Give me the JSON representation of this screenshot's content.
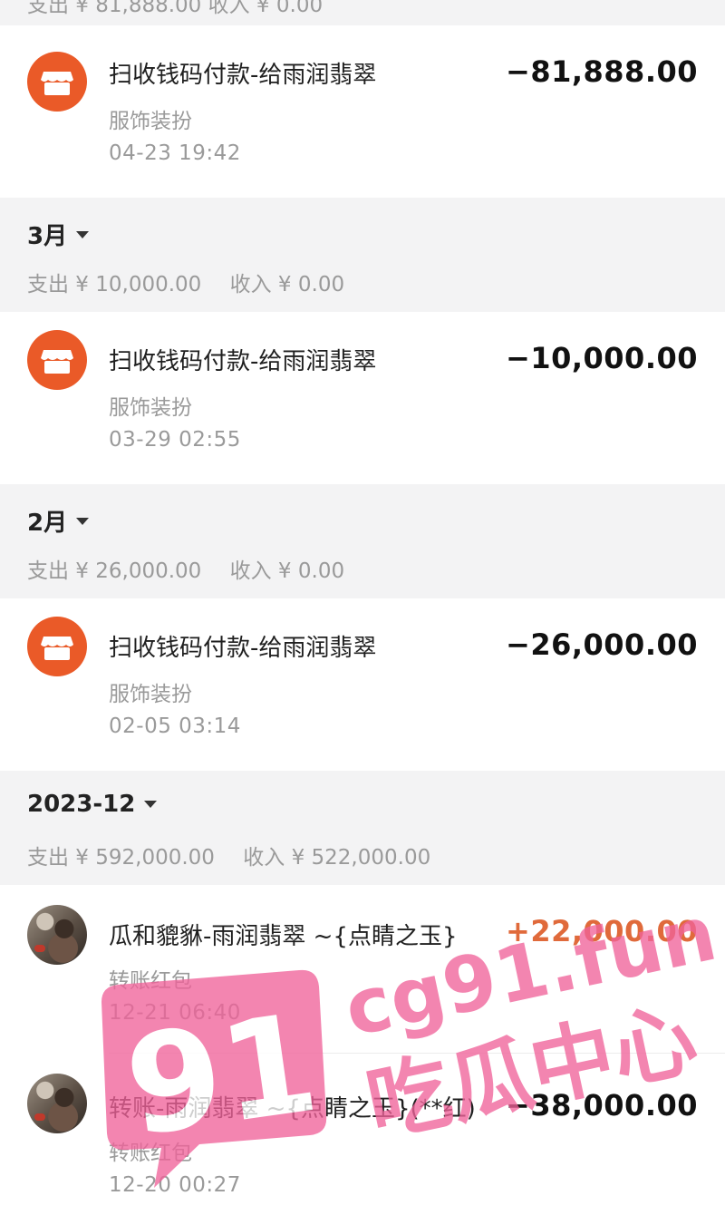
{
  "top_cut": {
    "text": "支出 ¥ 81,888.00    收入 ¥ 0.00"
  },
  "colors": {
    "accent_orange": "#ea5a28",
    "income_orange": "#e06a3b",
    "watermark_pink": "#f0639a"
  },
  "entries_april": [
    {
      "icon": "shop-icon",
      "title": "扫收钱码付款-给雨润翡翠",
      "category": "服饰装扮",
      "time": "04-23  19:42",
      "amount": "−81,888.00"
    }
  ],
  "month_march": {
    "label": "3月",
    "expense": "支出 ¥ 10,000.00",
    "income": "收入 ¥ 0.00"
  },
  "entries_march": [
    {
      "icon": "shop-icon",
      "title": "扫收钱码付款-给雨润翡翠",
      "category": "服饰装扮",
      "time": "03-29  02:55",
      "amount": "−10,000.00"
    }
  ],
  "month_feb": {
    "label": "2月",
    "expense": "支出 ¥ 26,000.00",
    "income": "收入 ¥ 0.00"
  },
  "entries_feb": [
    {
      "icon": "shop-icon",
      "title": "扫收钱码付款-给雨润翡翠",
      "category": "服饰装扮",
      "time": "02-05  03:14",
      "amount": "−26,000.00"
    }
  ],
  "month_dec": {
    "label": "2023-12",
    "expense": "支出 ¥ 592,000.00",
    "income": "收入 ¥ 522,000.00"
  },
  "entries_dec": [
    {
      "icon": "avatar",
      "title": "瓜和貔貅-雨润翡翠 ~{点睛之玉}",
      "category": "转账红包",
      "time": "12-21  06:40",
      "amount": "+22,000.00"
    },
    {
      "icon": "avatar",
      "title": "转账-雨润翡翠 ~{点睛之玉}(**红)",
      "category": "转账红包",
      "time": "12-20  00:27",
      "amount": "−38,000.00"
    }
  ],
  "watermark": {
    "site": "cg91.fun",
    "number": "91",
    "slogan": "吃瓜中心"
  }
}
